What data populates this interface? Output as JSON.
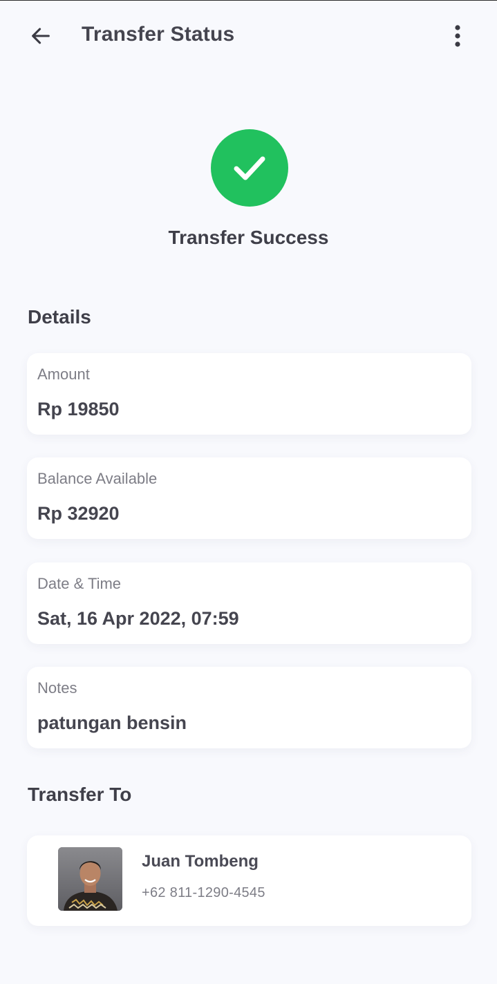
{
  "header": {
    "title": "Transfer Status",
    "back_icon": "arrow-left-icon",
    "menu_icon": "more-vertical-icon"
  },
  "status": {
    "icon": "check-circle-icon",
    "color": "#21c15e",
    "text": "Transfer Success"
  },
  "details": {
    "title": "Details",
    "items": [
      {
        "label": "Amount",
        "value": "Rp 19850"
      },
      {
        "label": "Balance Available",
        "value": "Rp 32920"
      },
      {
        "label": "Date & Time",
        "value": "Sat, 16 Apr 2022, 07:59"
      },
      {
        "label": "Notes",
        "value": "patungan bensin"
      }
    ]
  },
  "transfer_to": {
    "title": "Transfer To",
    "name": "Juan Tombeng",
    "phone": "+62 811-1290-4545"
  }
}
